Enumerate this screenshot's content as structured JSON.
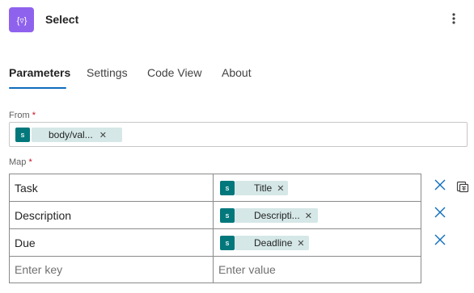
{
  "header": {
    "title": "Select",
    "action_icon": "select-data-operation-icon",
    "accent": "#8f62ee"
  },
  "tabs": [
    {
      "label": "Parameters",
      "active": true
    },
    {
      "label": "Settings",
      "active": false
    },
    {
      "label": "Code View",
      "active": false
    },
    {
      "label": "About",
      "active": false
    }
  ],
  "from": {
    "label": "From",
    "required_mark": "*",
    "token": {
      "icon": "sharepoint-icon",
      "text": "body/val..."
    }
  },
  "map": {
    "label": "Map",
    "required_mark": "*",
    "rows": [
      {
        "key": "Task",
        "value_token": "Title"
      },
      {
        "key": "Description",
        "value_token": "Descripti..."
      },
      {
        "key": "Due",
        "value_token": "Deadline"
      }
    ],
    "new_row": {
      "key_placeholder": "Enter key",
      "value_placeholder": "Enter value"
    }
  },
  "token_color": "#d5e7e7",
  "sharepoint_color": "#03787c"
}
